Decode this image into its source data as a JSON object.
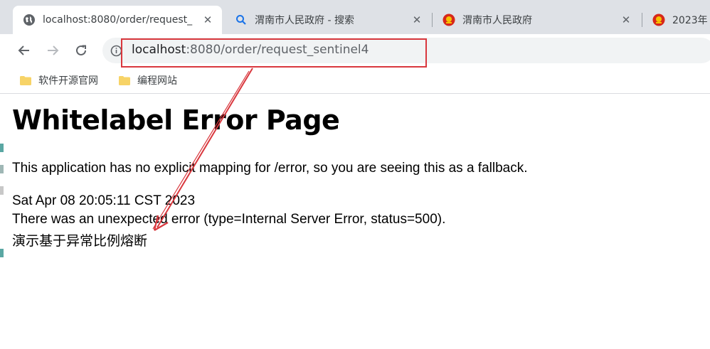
{
  "browser": {
    "tabs": [
      {
        "title": "localhost:8080/order/request_",
        "favicon": "globe-icon",
        "active": true
      },
      {
        "title": "渭南市人民政府 - 搜索",
        "favicon": "search-icon",
        "active": false
      },
      {
        "title": "渭南市人民政府",
        "favicon": "emblem-icon",
        "active": false
      },
      {
        "title": "2023年",
        "favicon": "emblem-icon",
        "active": false
      }
    ],
    "close_glyph": "✕",
    "address": {
      "host": "localhost",
      "path": ":8080/order/request_sentinel4"
    },
    "bookmarks": [
      {
        "label": "软件开源官网",
        "icon": "folder-icon"
      },
      {
        "label": "编程网站",
        "icon": "folder-icon"
      }
    ]
  },
  "page": {
    "title": "Whitelabel Error Page",
    "message": "This application has no explicit mapping for /error, so you are seeing this as a fallback.",
    "timestamp": "Sat Apr 08 20:05:11 CST 2023",
    "error": "There was an unexpected error (type=Internal Server Error, status=500).",
    "detail": "演示基于异常比例熔断"
  },
  "annotation": {
    "color": "#d9373d"
  }
}
